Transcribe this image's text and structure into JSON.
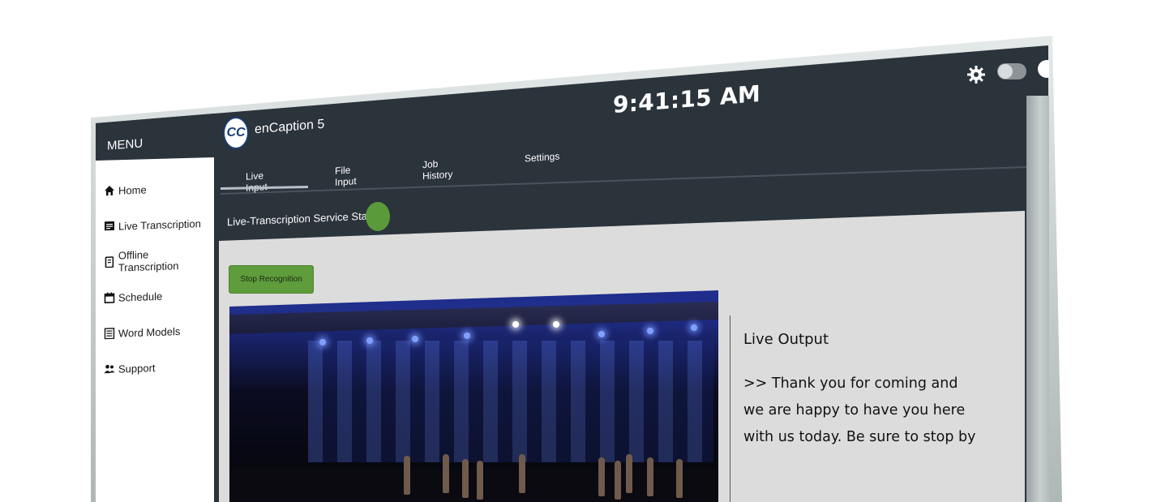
{
  "header": {
    "clock": "9:41:15 AM",
    "app_name": "enCaption 5",
    "logo_text": "CC"
  },
  "sidebar": {
    "title": "MENU",
    "items": [
      {
        "label": "Home",
        "icon": "home-icon"
      },
      {
        "label": "Live Transcription",
        "icon": "transcript-icon"
      },
      {
        "label": "Offline Transcription",
        "icon": "file-icon"
      },
      {
        "label": "Schedule",
        "icon": "calendar-icon"
      },
      {
        "label": "Word Models",
        "icon": "list-icon"
      },
      {
        "label": "Support",
        "icon": "people-icon"
      }
    ]
  },
  "tabs": [
    {
      "label": "Live Input",
      "active": true
    },
    {
      "label": "File Input",
      "active": false
    },
    {
      "label": "Job History",
      "active": false
    },
    {
      "label": "Settings",
      "active": false
    }
  ],
  "status": {
    "label": "Live-Transcription Service Status:",
    "color": "#5a9a3a"
  },
  "controls": {
    "stop_label": "Stop Recognition"
  },
  "output": {
    "title": "Live Output",
    "lines": [
      ">> Thank you for coming and",
      "we are happy to have you here",
      "with us today. Be sure to stop by"
    ]
  },
  "colors": {
    "app_bar": "#2b333b",
    "accent_green": "#5e9c3c",
    "content_bg": "#dcdcdc"
  }
}
